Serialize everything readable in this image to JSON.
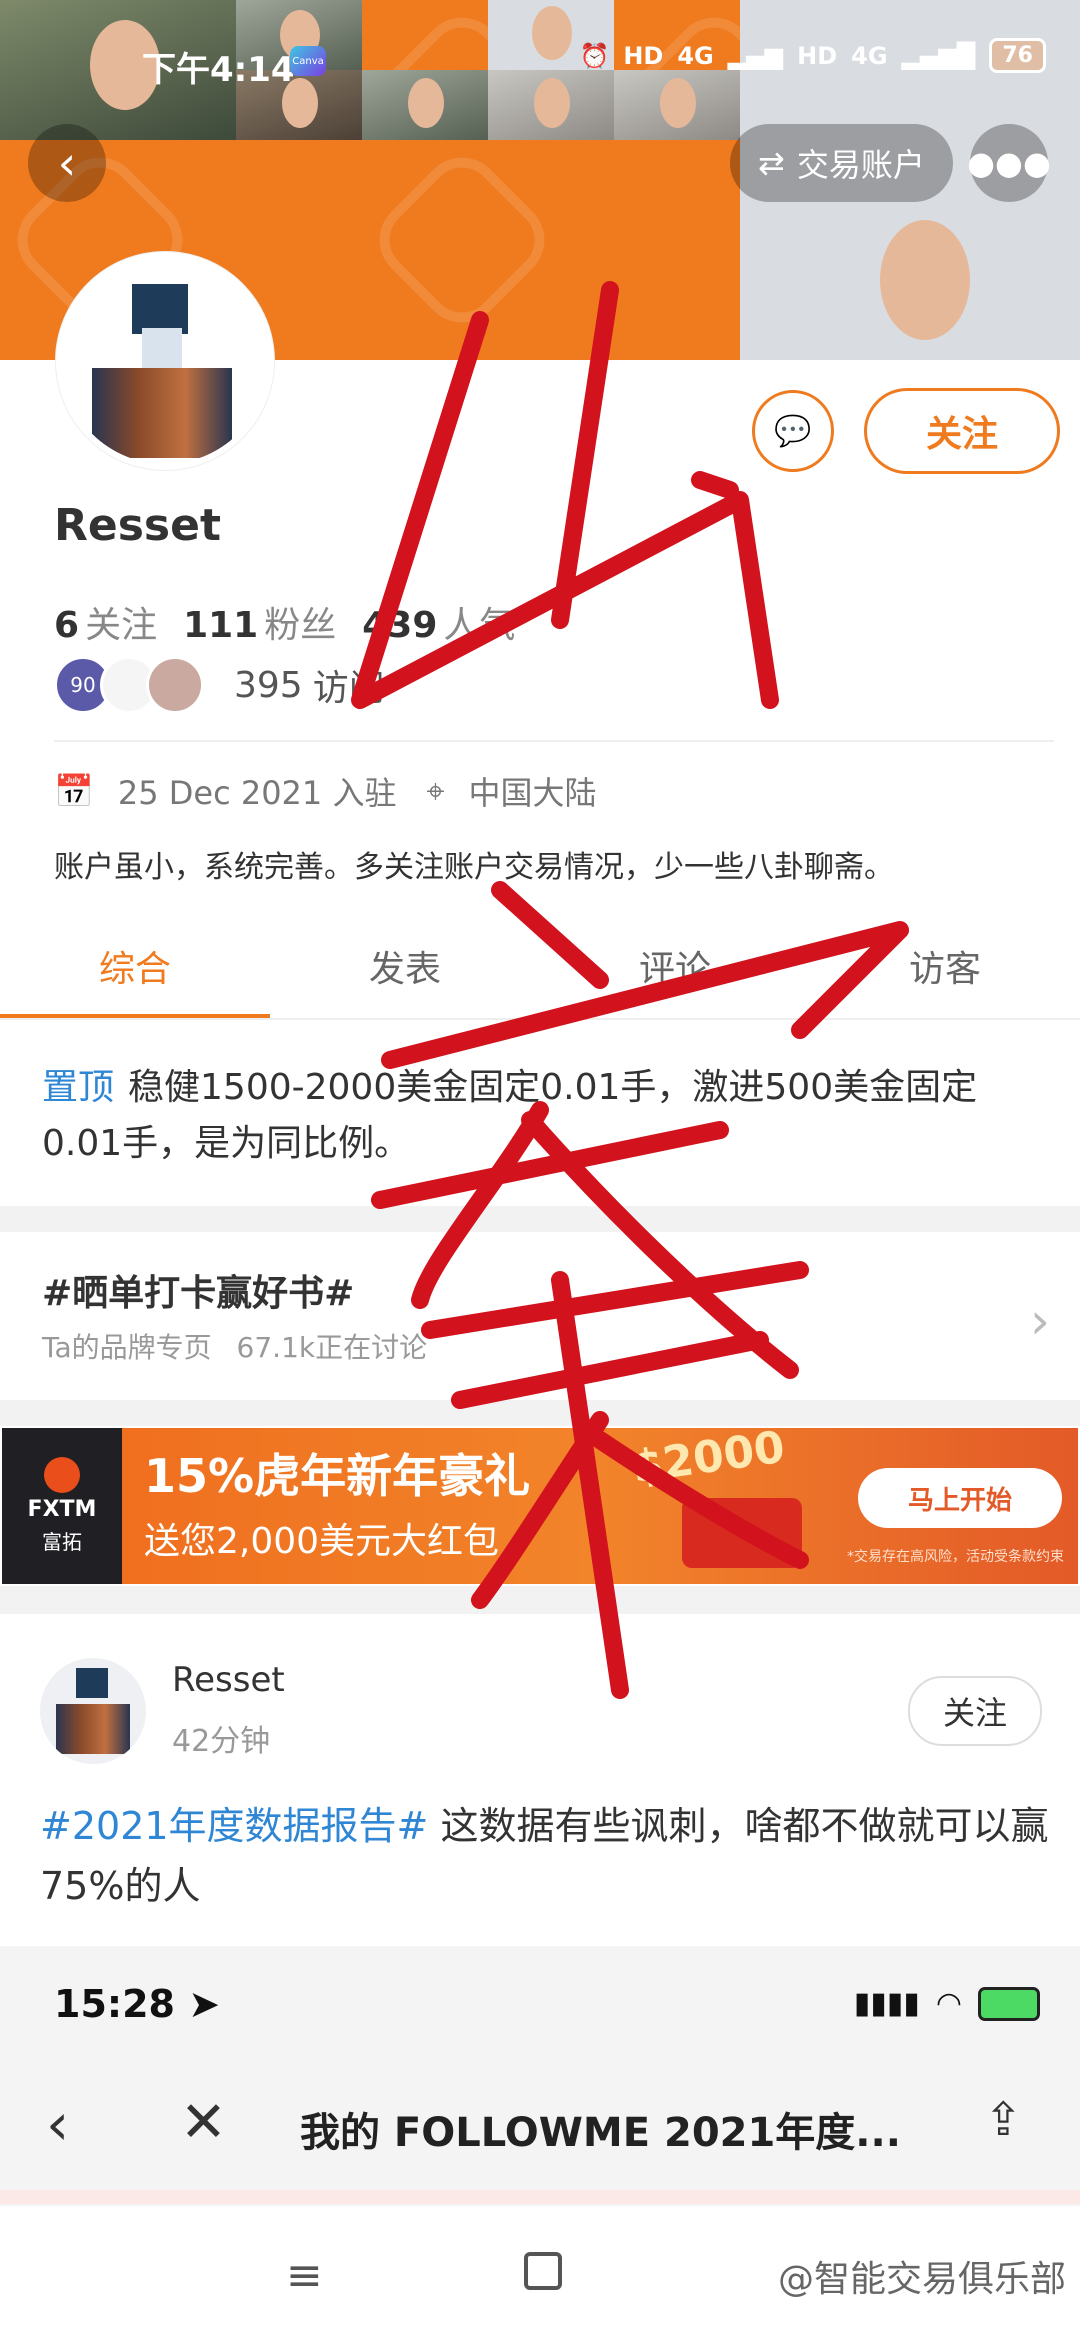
{
  "status_bar": {
    "time": "下午4:14",
    "app_badge": "Canva",
    "network1": "4G",
    "network2": "4G",
    "hd1": "HD",
    "hd2": "HD",
    "battery": "76"
  },
  "header": {
    "back_icon": "back-arrow-icon",
    "trade_account_label": "交易账户",
    "more_icon": "more-dots-icon"
  },
  "profile": {
    "name": "Resset",
    "follow_label": "关注",
    "following_count": "6",
    "following_label": "关注",
    "fans_count": "111",
    "fans_label": "粉丝",
    "popularity_count": "439",
    "popularity_label": "人气",
    "visitor_badge": "90",
    "visits_count": "395",
    "visits_label": "访问",
    "joined_date": "25 Dec 2021 入驻",
    "location": "中国大陆",
    "bio": "账户虽小，系统完善。多关注账户交易情况，少一些八卦聊斋。"
  },
  "tabs": [
    {
      "label": "综合",
      "active": true
    },
    {
      "label": "发表",
      "active": false
    },
    {
      "label": "评论",
      "active": false
    },
    {
      "label": "访客",
      "active": false
    }
  ],
  "pinned": {
    "tag": "置顶",
    "text": "稳健1500-2000美金固定0.01手，激进500美金固定0.01手，是为同比例。"
  },
  "topic": {
    "title": "#晒单打卡赢好书#",
    "sub_brand": "Ta的品牌专页",
    "sub_discussion": "67.1k正在讨论"
  },
  "ad": {
    "brand_top": "FXTM",
    "brand_bottom": "富拓",
    "title": "15%虎年新年豪礼",
    "subtitle": "送您2,000美元大红包",
    "amount": "$2000",
    "cta": "马上开始",
    "disclaimer": "*交易存在高风险，活动受条款约束"
  },
  "post": {
    "author": "Resset",
    "time": "42分钟",
    "follow_label": "关注",
    "tag": "#2021年度数据报告#",
    "text": " 这数据有些讽刺，啥都不做就可以赢75%的人"
  },
  "second_screen": {
    "time": "15:28",
    "title": "我的 FOLLOWME 2021年度...",
    "back_icon": "back-chevron-icon",
    "close_icon": "close-icon",
    "share_icon": "share-icon"
  },
  "system_nav": {
    "watermark": "@智能交易俱乐部"
  },
  "colors": {
    "accent": "#f07a1e",
    "link": "#2f86d4",
    "scribble": "#d2121c"
  }
}
